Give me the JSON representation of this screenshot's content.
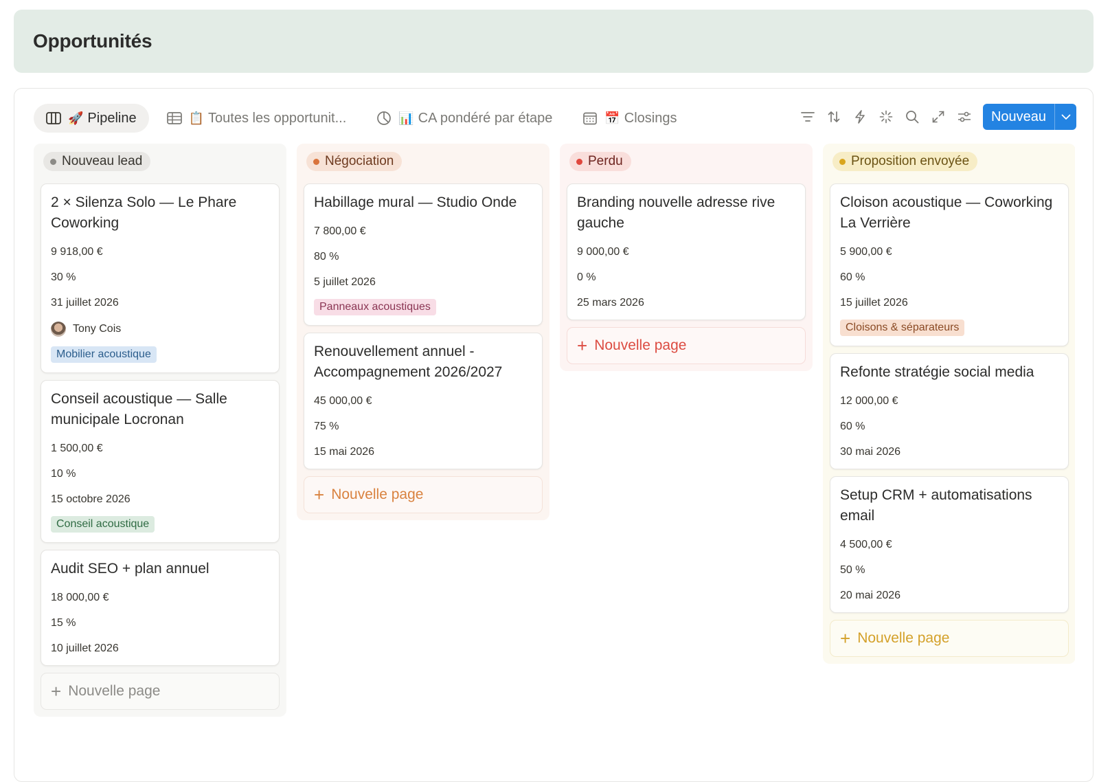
{
  "header": {
    "title": "Opportunités"
  },
  "tabs": [
    {
      "label": "Pipeline",
      "emoji": "🚀",
      "icon": "board-icon",
      "active": true
    },
    {
      "label": "Toutes les opportunit...",
      "emoji": "📋",
      "icon": "table-icon",
      "active": false
    },
    {
      "label": "CA pondéré par étape",
      "emoji": "📊",
      "icon": "pie-chart-icon",
      "active": false
    },
    {
      "label": "Closings",
      "emoji": "📅",
      "icon": "calendar-icon",
      "active": false
    }
  ],
  "toolbar": {
    "icons": [
      "filter-icon",
      "sort-icon",
      "lightning-icon",
      "sparkle-icon",
      "search-icon",
      "expand-icon",
      "settings-sliders-icon"
    ],
    "new_label": "Nouveau"
  },
  "new_page_label": "Nouvelle page",
  "columns": [
    {
      "name": "Nouveau lead",
      "colors": {
        "bg": "#f7f7f5",
        "pill": "#e8e7e4",
        "dot": "#8c8b87",
        "text": "#37352f",
        "new_border": "#e8e7e4",
        "new_text": "#8c8b87"
      },
      "cards": [
        {
          "title": "2 × Silenza Solo — Le Phare Coworking",
          "amount": "9 918,00 €",
          "probability": "30 %",
          "date": "31 juillet 2026",
          "owner": "Tony Cois",
          "tag": "Mobilier acoustique",
          "tag_bg": "#d8e6f5",
          "tag_fg": "#2b5d8c"
        },
        {
          "title": "Conseil acoustique — Salle municipale Locronan",
          "amount": "1 500,00 €",
          "probability": "10 %",
          "date": "15 octobre 2026",
          "tag": "Conseil acoustique",
          "tag_bg": "#dcebe0",
          "tag_fg": "#2f6b43"
        },
        {
          "title": "Audit SEO + plan annuel",
          "amount": "18 000,00 €",
          "probability": "15 %",
          "date": "10 juillet 2026"
        }
      ]
    },
    {
      "name": "Négociation",
      "colors": {
        "bg": "#fcf5f1",
        "pill": "#f7e2d6",
        "dot": "#d9733b",
        "text": "#6e3a1f",
        "new_border": "#f4e2d8",
        "new_text": "#d9823f"
      },
      "cards": [
        {
          "title": "Habillage mural — Studio Onde",
          "amount": "7 800,00 €",
          "probability": "80 %",
          "date": "5 juillet 2026",
          "tag": "Panneaux acoustiques",
          "tag_bg": "#f8dde6",
          "tag_fg": "#8a3553"
        },
        {
          "title": "Renouvellement annuel - Accompagnement 2026/2027",
          "amount": "45 000,00 €",
          "probability": "75 %",
          "date": "15 mai 2026"
        }
      ]
    },
    {
      "name": "Perdu",
      "colors": {
        "bg": "#fdf4f3",
        "pill": "#f9dedb",
        "dot": "#e0473d",
        "text": "#6e2520",
        "new_border": "#f6dcd9",
        "new_text": "#dc4c42"
      },
      "cards": [
        {
          "title": "Branding nouvelle adresse rive gauche",
          "amount": "9 000,00 €",
          "probability": "0 %",
          "date": "25 mars 2026"
        }
      ]
    },
    {
      "name": "Proposition envoyée",
      "colors": {
        "bg": "#fcfaef",
        "pill": "#f7edc6",
        "dot": "#d9a51d",
        "text": "#6b5314",
        "new_border": "#f3ebcb",
        "new_text": "#d4a12a"
      },
      "cards": [
        {
          "title": "Cloison acoustique — Coworking La Verrière",
          "amount": "5 900,00 €",
          "probability": "60 %",
          "date": "15 juillet 2026",
          "tag": "Cloisons & séparateurs",
          "tag_bg": "#f8dfd0",
          "tag_fg": "#8a4a24"
        },
        {
          "title": "Refonte stratégie social media",
          "amount": "12 000,00 €",
          "probability": "60 %",
          "date": "30 mai 2026"
        },
        {
          "title": "Setup CRM + automatisations email",
          "amount": "4 500,00 €",
          "probability": "50 %",
          "date": "20 mai 2026"
        }
      ]
    }
  ]
}
